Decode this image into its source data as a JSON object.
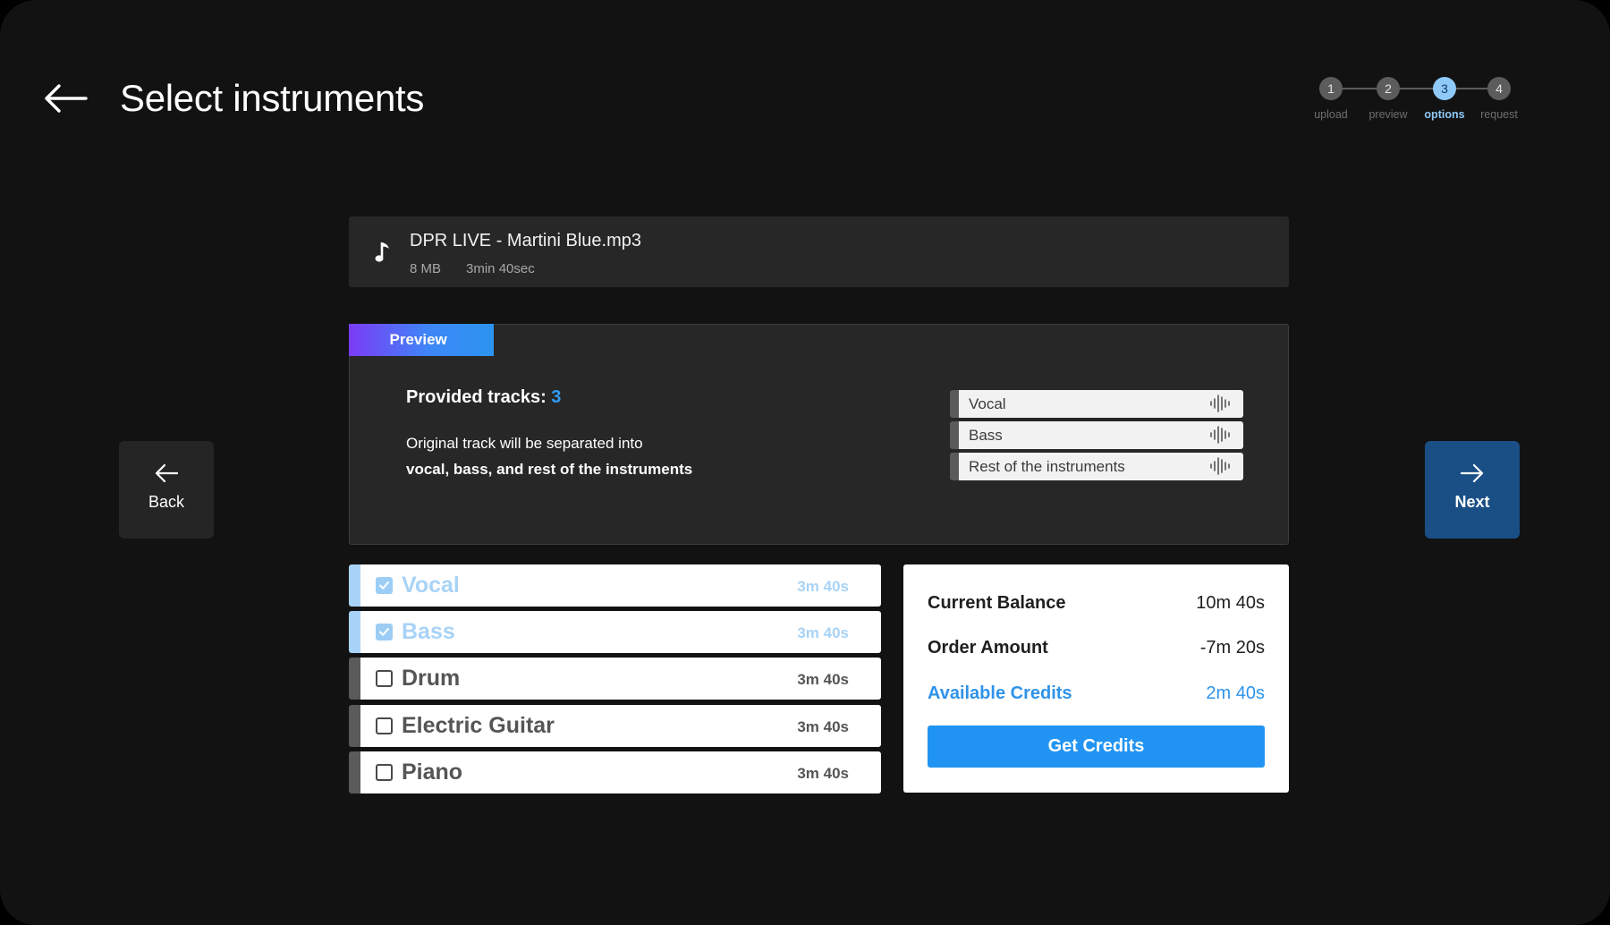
{
  "header": {
    "title": "Select instruments"
  },
  "stepper": {
    "steps": [
      {
        "number": "1",
        "label": "upload"
      },
      {
        "number": "2",
        "label": "preview"
      },
      {
        "number": "3",
        "label": "options"
      },
      {
        "number": "4",
        "label": "request"
      }
    ],
    "active_step": 3
  },
  "file": {
    "name": "DPR LIVE - Martini Blue.mp3",
    "size": "8 MB",
    "duration": "3min 40sec",
    "icon": "music-note-icon"
  },
  "preview": {
    "tab_label": "Preview",
    "tracks_label": "Provided tracks:",
    "tracks_count": "3",
    "description_line1": "Original track will be separated into",
    "description_line2": "vocal, bass, and rest of the instruments",
    "tracks": [
      {
        "label": "Vocal",
        "icon": "waveform-icon"
      },
      {
        "label": "Bass",
        "icon": "waveform-icon"
      },
      {
        "label": "Rest of the instruments",
        "icon": "waveform-icon"
      }
    ]
  },
  "navigation": {
    "back_label": "Back",
    "next_label": "Next"
  },
  "instruments": [
    {
      "name": "Vocal",
      "duration": "3m 40s",
      "checked": true
    },
    {
      "name": "Bass",
      "duration": "3m 40s",
      "checked": true
    },
    {
      "name": "Drum",
      "duration": "3m 40s",
      "checked": false
    },
    {
      "name": "Electric Guitar",
      "duration": "3m 40s",
      "checked": false
    },
    {
      "name": "Piano",
      "duration": "3m 40s",
      "checked": false
    }
  ],
  "balance": {
    "current_label": "Current Balance",
    "current_value": "10m 40s",
    "order_label": "Order Amount",
    "order_value": "-7m 20s",
    "available_label": "Available Credits",
    "available_value": "2m 40s",
    "button_label": "Get Credits"
  },
  "colors": {
    "background": "#121212",
    "panel": "#272727",
    "accent": "#2194f3",
    "checked": "#a8d3f7",
    "next_button": "#1a4f86"
  }
}
